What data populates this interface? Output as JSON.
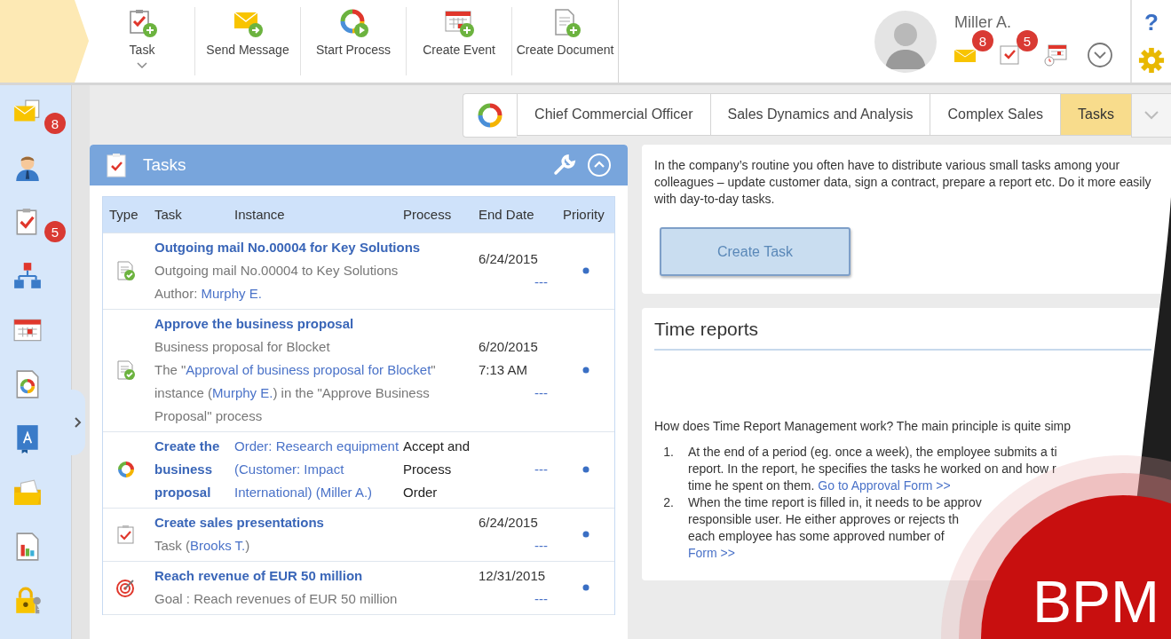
{
  "header": {
    "toolbar": [
      {
        "label": "Task",
        "kind": "task",
        "dropdown": true
      },
      {
        "label": "Send Message",
        "kind": "message",
        "dropdown": false
      },
      {
        "label": "Start Process",
        "kind": "process",
        "dropdown": false
      },
      {
        "label": "Create Event",
        "kind": "event",
        "dropdown": false
      },
      {
        "label": "Create Document",
        "kind": "document",
        "dropdown": false
      }
    ],
    "user": {
      "name": "Miller A.",
      "indicators": [
        {
          "kind": "mail",
          "badge": "8"
        },
        {
          "kind": "tasks",
          "badge": "5"
        },
        {
          "kind": "calendar"
        },
        {
          "kind": "expand"
        }
      ]
    },
    "utilities": [
      {
        "kind": "help",
        "label": "?"
      },
      {
        "kind": "settings"
      }
    ]
  },
  "sidebar": {
    "items": [
      {
        "kind": "mail",
        "badge": "8"
      },
      {
        "kind": "user"
      },
      {
        "kind": "tasks",
        "badge": "5"
      },
      {
        "kind": "org"
      },
      {
        "kind": "calendar"
      },
      {
        "kind": "process"
      },
      {
        "kind": "book"
      },
      {
        "kind": "folder"
      },
      {
        "kind": "report"
      },
      {
        "kind": "lock"
      }
    ]
  },
  "tabs": [
    {
      "label": "Chief Commercial Officer",
      "selected": false
    },
    {
      "label": "Sales Dynamics and Analysis",
      "selected": false
    },
    {
      "label": "Complex Sales",
      "selected": false
    },
    {
      "label": "Tasks",
      "selected": true
    }
  ],
  "tasks_panel": {
    "title": "Tasks",
    "columns": [
      "Type",
      "Task",
      "Instance",
      "Process",
      "End Date",
      "Priority"
    ],
    "rows": [
      {
        "kind": "document",
        "title": "Outgoing mail No.00004 for Key Solutions",
        "details": [
          [
            {
              "text": "Outgoing mail No.00004 to Key Solutions"
            }
          ],
          [
            {
              "text": "Author: "
            },
            {
              "text": "Murphy E.",
              "link": true
            }
          ]
        ],
        "end_date": "6/24/2015",
        "due": "---"
      },
      {
        "kind": "document",
        "title": "Approve the business proposal",
        "details": [
          [
            {
              "text": "Business proposal for Blocket"
            }
          ],
          [
            {
              "text": "The \""
            },
            {
              "text": "Approval of business proposal for Blocket",
              "link": true
            },
            {
              "text": "\" instance ("
            },
            {
              "text": "Murphy E.",
              "link": true
            },
            {
              "text": ") in the \"Approve Business Proposal\" process"
            }
          ]
        ],
        "end_date": "6/20/2015 7:13 AM",
        "due": "---"
      },
      {
        "kind": "process",
        "title": "Create the business proposal",
        "instance": "Order: Research equipment (Customer: Impact International) (Miller A.)",
        "process": "Accept and Process Order",
        "due": "---"
      },
      {
        "kind": "task",
        "title": "Create sales presentations",
        "details": [
          [
            {
              "text": "Task ("
            },
            {
              "text": "Brooks T.",
              "link": true
            },
            {
              "text": ")"
            }
          ]
        ],
        "end_date": "6/24/2015",
        "due": "---"
      },
      {
        "kind": "goal",
        "title": "Reach revenue of EUR 50 million",
        "details": [
          [
            {
              "text": "Goal : Reach revenues of EUR 50 million"
            }
          ]
        ],
        "end_date": "12/31/2015",
        "due": "---"
      }
    ]
  },
  "intro_panel": {
    "text": "In the company’s routine you often have to distribute various small tasks among your colleagues – update customer data, sign a contract, prepare a report etc. Do it more easily with day-to-day tasks.",
    "button": "Create Task"
  },
  "time_reports": {
    "title": "Time reports",
    "question": "How does Time Report Management work? The main principle is quite simp",
    "steps": [
      {
        "number": "1.",
        "lines": [
          {
            "text": "At the end of a period (eg. once a week), the employee submits a ti"
          },
          {
            "text": "report. In the report, he specifies the tasks he worked on and how r"
          },
          {
            "text": "time he spent on them.",
            "link": "Go to Approval Form >>"
          }
        ]
      },
      {
        "number": "2.",
        "lines": [
          {
            "text": "When the time report is filled in, it needs to be approv"
          },
          {
            "text": "responsible user. He either approves or rejects th"
          },
          {
            "text": "each employee has some approved number of"
          },
          {
            "link": "Form >>"
          }
        ]
      }
    ]
  },
  "overlay": {
    "label": "BPM"
  }
}
